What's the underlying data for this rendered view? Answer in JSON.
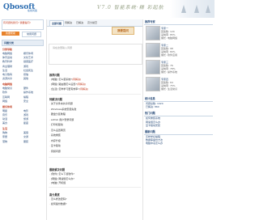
{
  "header": {
    "logo": "Qbosoft",
    "logo_suffix": "7.com",
    "logo_sub": "在线问答",
    "slogan": "V7.0 智能系统·精 彩起航"
  },
  "left": {
    "notice": "有问题找我们? 我要提问!",
    "btn_help": "我要帮助",
    "btn_settings": "常用问题",
    "categories_title": "问题分类",
    "sections": [
      {
        "head": "分类导航",
        "links": [
          "电脑网络",
          "娱乐休闲",
          "体育运动",
          "文化艺术",
          "教育科学",
          "健康医疗",
          "商业理财",
          "游戏",
          "生活",
          "社会民生",
          "电子数码",
          "烦恼",
          "资源共享",
          "其他"
        ]
      },
      {
        "head": "电脑网络",
        "links": [
          "电脑常识",
          "硬件",
          "软件",
          "操作系统",
          "互联网",
          "编程",
          "网络",
          "安全"
        ]
      }
    ],
    "sections2": [
      {
        "head": "娱乐休闲",
        "links": [
          "明星",
          "电影",
          "音乐",
          "游戏",
          "动漫",
          "旅游",
          "美食",
          "星座"
        ]
      },
      {
        "head": "生活",
        "links": [
          "购物",
          "美容",
          "家居",
          "交通",
          "宠物",
          "服装"
        ]
      }
    ]
  },
  "center": {
    "tabs": [
      "全部问题",
      "待解决",
      "已解决",
      "高分悬赏"
    ],
    "ask_button": "我要提问",
    "sub_placeholder": "请在这里输入问题",
    "hot_title": "推荐问题",
    "hot_rows": [
      {
        "text": "[电脑] 怎么装系统?",
        "tag": "(待解决)"
      },
      {
        "text": "[网络] 路由器怎么设置?",
        "tag": "(待解决)"
      },
      {
        "text": "[生活] 怎样学习更有效率?",
        "tag": "(待解决)"
      }
    ],
    "latest_title": "待解决问题",
    "latest_rows": [
      "关于文件夹共享问题",
      "Windows系统安装失败",
      "硬盘分区教程",
      "admin 用户登录问题",
      "打印机驱动",
      "怎么设置网页",
      "系统重装",
      "内存升级",
      "显卡驱动",
      "音频问题"
    ],
    "solved_title": "最新解决问题",
    "solved_rows": [
      "[软件] 怎么下载软件?",
      "[网络] 网速慢怎么办?",
      "[电脑] 开机慢"
    ],
    "reward_title": "高分悬赏",
    "reward_rows": [
      "怎么修改密码?",
      "如何备份数据?"
    ]
  },
  "right": {
    "experts_title": "推荐专家",
    "experts": [
      {
        "name": "专家一",
        "lines": [
          "回答数: 120",
          "采纳率: 85%",
          "擅长: 电脑网络"
        ]
      },
      {
        "name": "专家二",
        "lines": [
          "回答数: 98",
          "采纳率: 80%",
          "擅长: 软件应用"
        ]
      },
      {
        "name": "专家三",
        "lines": [
          "回答数: 76",
          "采纳率: 78%",
          "擅长: 操作系统"
        ]
      },
      {
        "name": "专家四",
        "lines": [
          "回答数: 64",
          "采纳率: 75%",
          "擅长: 生活常识"
        ]
      }
    ],
    "stats_title": "统计信息",
    "stats_rows": [
      "问题总数: 1024",
      "已解决: 860"
    ],
    "hot_title": "热门问题",
    "hot_rows": [
      "如何重装系统",
      "网速慢怎么办",
      "显卡驱动安装"
    ],
    "links_title": "最新问题",
    "links_rows": [
      "怎样学好编程",
      "数据库备份方法",
      "电脑中毒怎么办"
    ]
  },
  "colors": {
    "accent": "#2a4d7a",
    "orange": "#e8832c",
    "highlight": "#c03b1e"
  }
}
